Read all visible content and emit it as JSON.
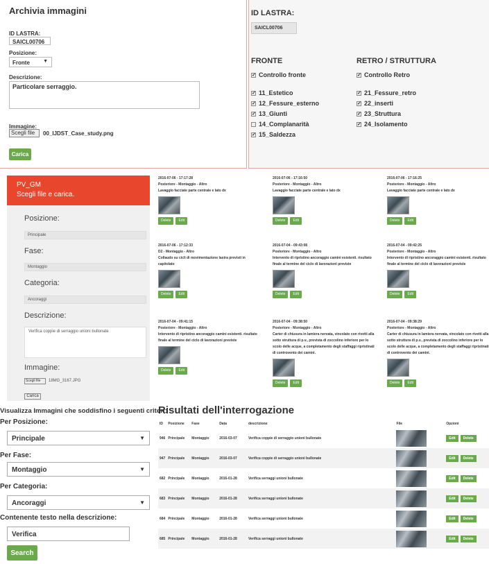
{
  "archive": {
    "title": "Archivia immagini",
    "id_label": "ID LASTRA:",
    "id_value": "SAICL00706",
    "position_label": "Posizione:",
    "position_value": "Fronte",
    "description_label": "Descrizione:",
    "description_value": "Particolare serraggio.",
    "image_label": "Immagine:",
    "file_button": "Scegli file",
    "file_name": "00_IJDST_Case_study.png",
    "submit_label": "Carica"
  },
  "slab": {
    "title": "ID LASTRA:",
    "value": "SAICL00706",
    "front_heading": "FRONTE",
    "back_heading": "RETRO / STRUTTURA",
    "front_items": [
      {
        "label": "Controllo fronte",
        "checked": true
      },
      {
        "label": "11_Estetico",
        "checked": true
      },
      {
        "label": "12_Fessure_esterno",
        "checked": true
      },
      {
        "label": "13_Giunti",
        "checked": true
      },
      {
        "label": "14_Complanarità",
        "checked": false
      },
      {
        "label": "15_Saldezza",
        "checked": true
      }
    ],
    "back_items": [
      {
        "label": "Controllo Retro",
        "checked": true
      },
      {
        "label": "21_Fessure_retro",
        "checked": true
      },
      {
        "label": "22_inserti",
        "checked": true
      },
      {
        "label": "23_Struttura",
        "checked": true
      },
      {
        "label": "24_Isolamento",
        "checked": true
      }
    ]
  },
  "upload": {
    "header_title": "PV_GM",
    "header_subtitle": "Scegli file e carica.",
    "position_label": "Posizione:",
    "position_value": "Principale",
    "phase_label": "Fase:",
    "phase_value": "Montaggio",
    "category_label": "Categoria:",
    "category_value": "Ancoraggi",
    "description_label": "Descrizione:",
    "description_value": "Verifica coppie di serraggio unioni bullonate",
    "image_label": "Immagine:",
    "file_button": "Scegli file",
    "file_name": "18MG_3167.JPG",
    "submit_label": "Carica"
  },
  "gallery": {
    "delete_label": "Delete",
    "edit_label": "Edit",
    "cards": [
      {
        "date": "2016-07-06 - 17:17:28",
        "meta": "Posteriore - Montaggio - Altro",
        "desc": "Lavaggio facciate parte centrale e lato dx"
      },
      {
        "date": "2016-07-06 - 17:16:50",
        "meta": "Posteriore - Montaggio - Altro",
        "desc": "Lavaggio facciate parte centrale e lato dx"
      },
      {
        "date": "2016-07-06 - 17:16:25",
        "meta": "Posteriore - Montaggio - Altro",
        "desc": "Lavaggio facciate parte centrale e lato dx"
      },
      {
        "date": "2016-07-06 - 17:12:33",
        "meta": "D2 - Montaggio - Altro",
        "desc": "Collaudo su cicli di movimentazione lastra previsti in capitolato"
      },
      {
        "date": "2016-07-04 - 09:43:08",
        "meta": "Posteriore - Montaggio - Altro",
        "desc": "Intervento di ripristino ancoraggio camini esistenti. risultato finale al termine del ciclo di lavorazioni previste"
      },
      {
        "date": "2016-07-04 - 09:42:25",
        "meta": "Posteriore - Montaggio - Altro",
        "desc": "Intervento di ripristino ancoraggio camini esistenti. risultato finale al termine del ciclo di lavorazioni previste"
      },
      {
        "date": "2016-07-04 - 09:41:15",
        "meta": "Posteriore - Montaggio - Altro",
        "desc": "Intervento di ripristino ancoraggio camini esistenti. risultato finale al termine del ciclo di lavorazioni previste"
      },
      {
        "date": "2016-07-04 - 09:38:50",
        "meta": "Posteriore - Montaggio - Altro",
        "desc": "Carter di chiusura in lamiera nervata, vincolato con rivetti alla sotto struttura di p.v., prevista di zoccolino inferiore per lo scolo delle acque, a completamento degli staffaggi ripristinati di controvento dei camini."
      },
      {
        "date": "2016-07-04 - 09:38:29",
        "meta": "Posteriore - Montaggio - Altro",
        "desc": "Carter di chiusura in lamiera nervata, vincolato con rivetti alla sotto struttura di p.v., prevista di zoccolino inferiore per lo scolo delle acque, a completamento degli staffaggi ripristinati di controvento dei camini."
      }
    ]
  },
  "search": {
    "title": "Visualizza Immagini che soddisfino i seguenti criteri:",
    "position_label": "Per Posizione:",
    "position_value": "Principale",
    "phase_label": "Per Fase:",
    "phase_value": "Montaggio",
    "category_label": "Per Categoria:",
    "category_value": "Ancoraggi",
    "text_label": "Contenente testo nella descrizione:",
    "text_value": "Verifica",
    "submit_label": "Search"
  },
  "results": {
    "title": "Risultati dell'interrogazione",
    "columns": [
      "ID",
      "Posizione",
      "Fase",
      "Data",
      "descrizione",
      "File",
      "Opzioni"
    ],
    "edit_label": "Edit",
    "delete_label": "Delete",
    "rows": [
      {
        "id": "946",
        "pos": "Principale",
        "fase": "Montaggio",
        "data": "2016-03-07",
        "desc": "Verifica coppie di serraggio unioni bullonate"
      },
      {
        "id": "947",
        "pos": "Principale",
        "fase": "Montaggio",
        "data": "2016-03-07",
        "desc": "Verifica coppie di serraggio unioni bullonate"
      },
      {
        "id": "682",
        "pos": "Principale",
        "fase": "Montaggio",
        "data": "2016-01-28",
        "desc": "Verifica serraggi unioni bullonate"
      },
      {
        "id": "683",
        "pos": "Principale",
        "fase": "Montaggio",
        "data": "2016-01-28",
        "desc": "Verifica serraggi unioni bullonate"
      },
      {
        "id": "684",
        "pos": "Principale",
        "fase": "Montaggio",
        "data": "2016-01-28",
        "desc": "Verifica serraggi unioni bullonate"
      },
      {
        "id": "685",
        "pos": "Principale",
        "fase": "Montaggio",
        "data": "2016-01-28",
        "desc": "Verifica serraggi unioni bullonate"
      }
    ]
  },
  "colors": {
    "accent_green": "#6aaa4b",
    "header_red": "#e8472e",
    "panel_border": "#e7a89c"
  }
}
